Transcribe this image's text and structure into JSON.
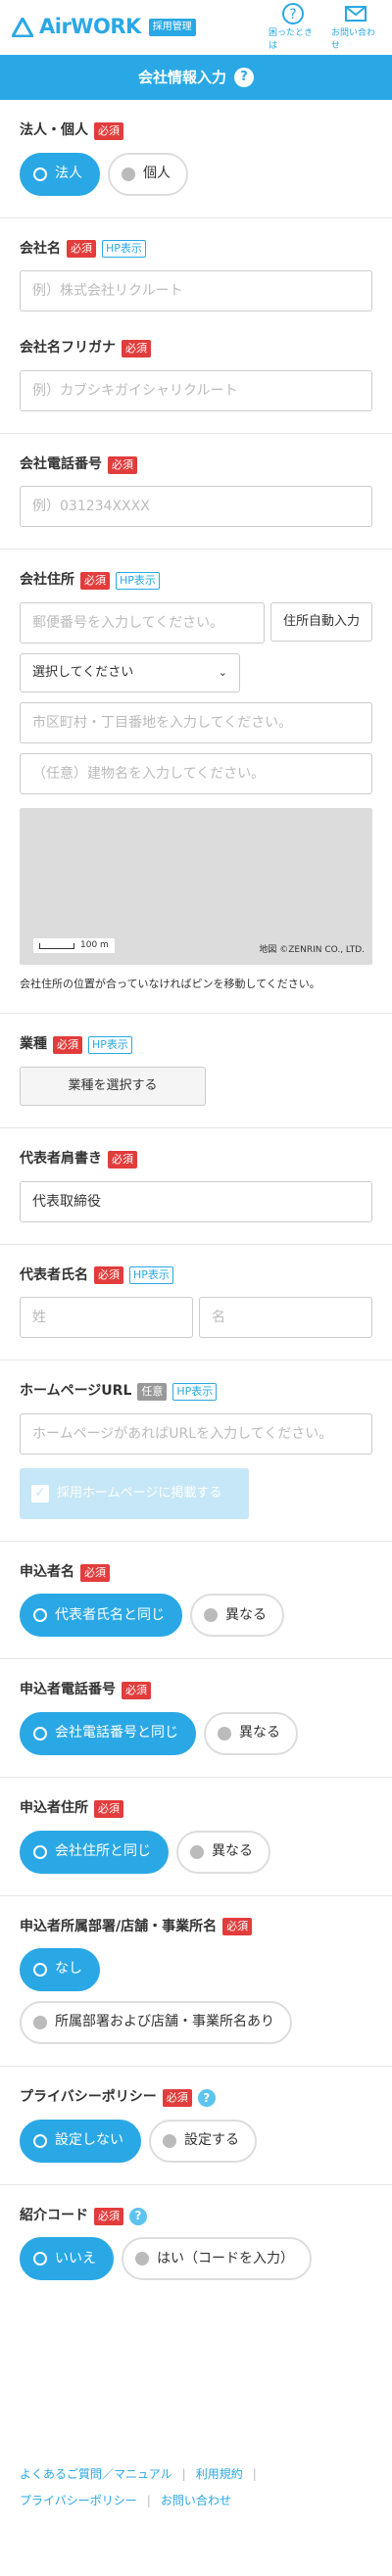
{
  "header": {
    "logo_text": "AirWORK",
    "logo_badge": "採用管理",
    "help_label": "困ったときは",
    "contact_label": "お問い合わせ",
    "brand_color": "#2aa8e5"
  },
  "title": {
    "text": "会社情報入力",
    "help_glyph": "?"
  },
  "tags": {
    "required": "必須",
    "hp": "HP表示",
    "optional": "任意"
  },
  "corporate": {
    "label": "法人・個人",
    "options": [
      "法人",
      "個人"
    ],
    "selected": "法人"
  },
  "company_name": {
    "label": "会社名",
    "placeholder": "例）株式会社リクルート"
  },
  "company_kana": {
    "label": "会社名フリガナ",
    "placeholder": "例）カブシキガイシャリクルート"
  },
  "company_phone": {
    "label": "会社電話番号",
    "placeholder": "例）031234XXXX"
  },
  "address": {
    "label": "会社住所",
    "postal_placeholder": "郵便番号を入力してください。",
    "auto_button": "住所自動入力",
    "prefecture": "選択してください",
    "street_placeholder": "市区町村・丁目番地を入力してください。",
    "building_placeholder": "（任意）建物名を入力してください。",
    "map_scale": "100 m",
    "map_credit": "地図 ©ZENRIN CO., LTD.",
    "note": "会社住所の位置が合っていなければピンを移動してください。"
  },
  "industry": {
    "label": "業種",
    "button": "業種を選択する"
  },
  "rep_title": {
    "label": "代表者肩書き",
    "value": "代表取締役"
  },
  "rep_name": {
    "label": "代表者氏名",
    "last_placeholder": "姓",
    "first_placeholder": "名"
  },
  "homepage": {
    "label": "ホームページURL",
    "placeholder": "ホームページがあればURLを入力してください。",
    "check_label": "採用ホームページに掲載する"
  },
  "applicant": {
    "label": "申込者名",
    "options": [
      "代表者氏名と同じ",
      "異なる"
    ]
  },
  "applicant_phone": {
    "label": "申込者電話番号",
    "options": [
      "会社電話番号と同じ",
      "異なる"
    ]
  },
  "applicant_address": {
    "label": "申込者住所",
    "options": [
      "会社住所と同じ",
      "異なる"
    ]
  },
  "department": {
    "label": "申込者所属部署/店舗・事業所名",
    "options": [
      "なし",
      "所属部署および店舗・事業所名あり"
    ]
  },
  "privacy": {
    "label": "プライバシーポリシー",
    "options": [
      "設定しない",
      "設定する"
    ]
  },
  "referral": {
    "label": "紹介コード",
    "options": [
      "いいえ",
      "はい（コードを入力）"
    ]
  },
  "footer": {
    "faq": "よくあるご質問／マニュアル",
    "terms": "利用規約",
    "privacy": "プライバシーポリシー",
    "contact": "お問い合わせ"
  }
}
